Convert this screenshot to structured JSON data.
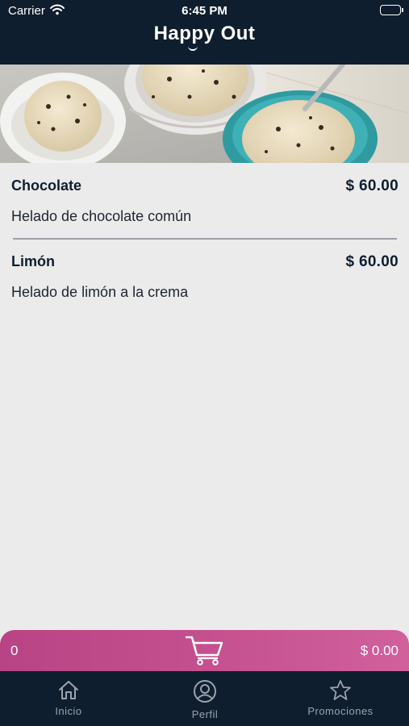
{
  "status_bar": {
    "carrier": "Carrier",
    "time": "6:45 PM"
  },
  "header": {
    "brand": "Happy Out"
  },
  "products": [
    {
      "name": "Chocolate",
      "price": "$ 60.00",
      "description": "Helado de chocolate común"
    },
    {
      "name": "Limón",
      "price": "$ 60.00",
      "description": "Helado de limón a la crema"
    }
  ],
  "cart": {
    "count": "0",
    "total": "$ 0.00"
  },
  "tabs": [
    {
      "label": "Inicio",
      "icon": "home-icon"
    },
    {
      "label": "Perfil",
      "icon": "user-circle-icon"
    },
    {
      "label": "Promociones",
      "icon": "star-icon"
    }
  ],
  "colors": {
    "dark_navy": "#0f1e2e",
    "cart_pink": "#c4508f",
    "background": "#ebebeb",
    "inactive_tab": "#9aa3ad"
  }
}
